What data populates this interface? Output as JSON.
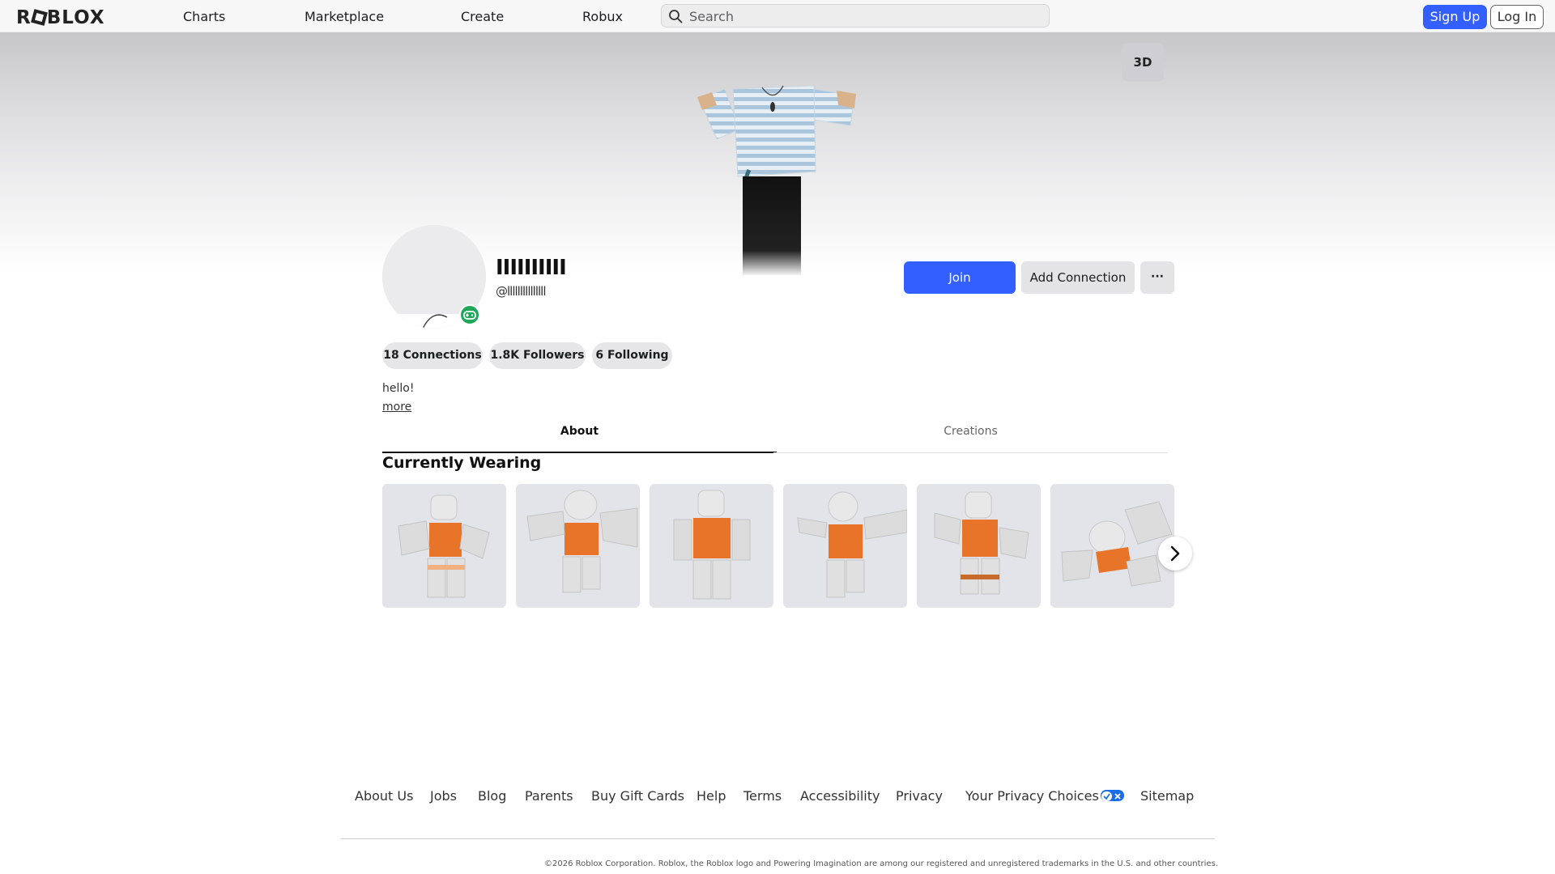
{
  "nav": {
    "logo": "ROBLOX",
    "links": [
      "Charts",
      "Marketplace",
      "Create",
      "Robux"
    ],
    "search_placeholder": "Search",
    "signup_label": "Sign Up",
    "login_label": "Log In"
  },
  "hero": {
    "view_toggle_label": "3D"
  },
  "profile": {
    "display_name": "IIIIIIIIII",
    "username": "@lllllllllllllll",
    "presence_icon": "game-controller-icon",
    "join_label": "Join",
    "add_connection_label": "Add Connection",
    "more_label": "···",
    "stats": [
      {
        "label": "18 Connections"
      },
      {
        "label": "1.8K Followers"
      },
      {
        "label": "6 Following"
      }
    ],
    "bio": "hello!",
    "bio_more_label": "more"
  },
  "tabs": [
    {
      "label": "About",
      "active": true
    },
    {
      "label": "Creations",
      "active": false
    }
  ],
  "wearing": {
    "title": "Currently Wearing",
    "item_count": 6,
    "next_icon": "chevron-right-icon"
  },
  "footer": {
    "links": [
      "About Us",
      "Jobs",
      "Blog",
      "Parents",
      "Buy Gift Cards",
      "Help",
      "Terms",
      "Accessibility",
      "Privacy",
      "Your Privacy Choices",
      "Sitemap"
    ],
    "copyright": "©2026 Roblox Corporation. Roblox, the Roblox logo and Powering Imagination are among our registered and unregistered trademarks in the U.S. and other countries."
  },
  "colors": {
    "accent": "#335fff",
    "presence": "#20a85a",
    "outfit_orange": "#e8742a"
  }
}
